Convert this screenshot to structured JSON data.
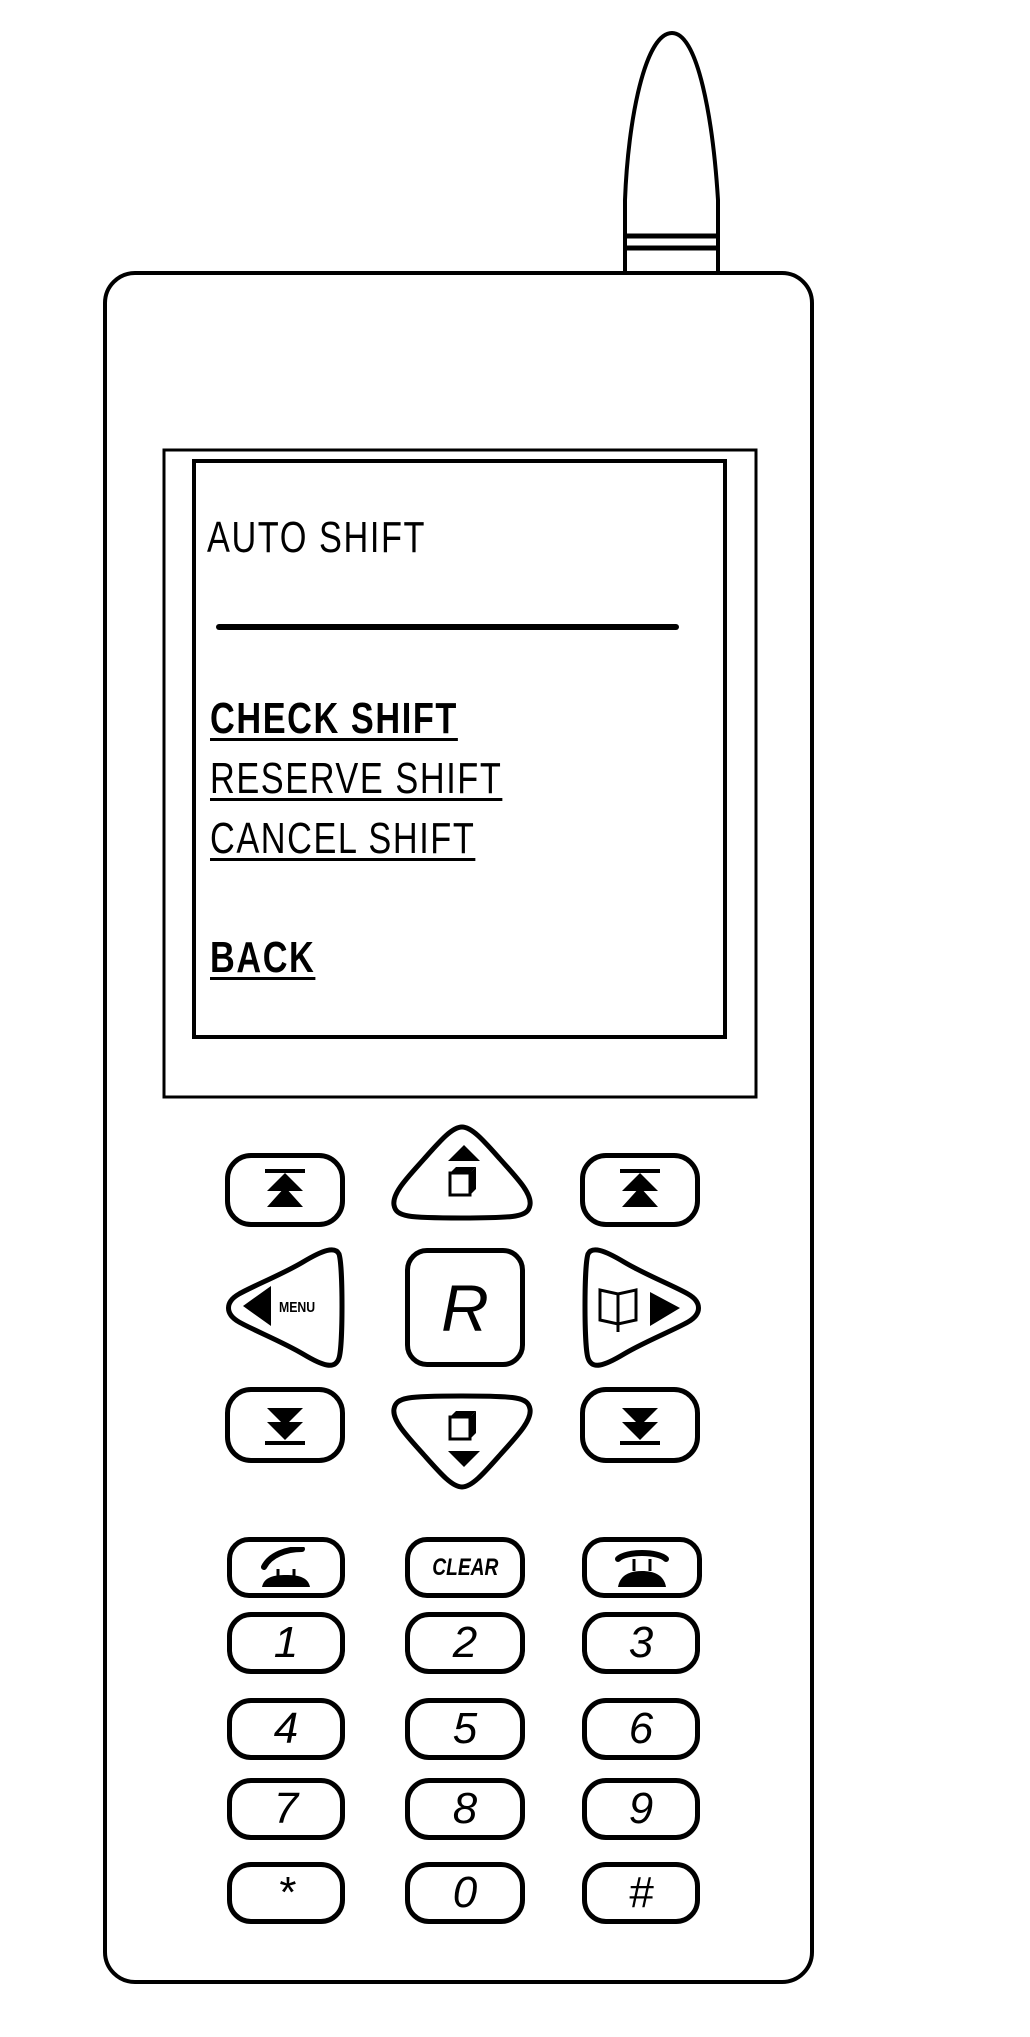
{
  "device": {
    "type": "mobile-phone-drawing",
    "screen": {
      "title": "AUTO SHIFT",
      "menu_items": [
        {
          "label": "CHECK SHIFT"
        },
        {
          "label": "RESERVE SHIFT"
        },
        {
          "label": "CANCEL SHIFT"
        }
      ],
      "back_label": "BACK"
    },
    "navigation_keys": {
      "scroll_top_left": {
        "icon": "double-up-arrow-bar-icon"
      },
      "page_up": {
        "icon": "page-up-icon"
      },
      "scroll_top_right": {
        "icon": "double-up-arrow-bar-icon"
      },
      "left_menu": {
        "icon": "left-triangle-icon",
        "label": "MENU"
      },
      "center": {
        "label": "R"
      },
      "right_book": {
        "icon": "book-icon"
      },
      "scroll_bottom_left": {
        "icon": "double-down-arrow-bar-icon"
      },
      "page_down": {
        "icon": "page-down-icon"
      },
      "scroll_bottom_right": {
        "icon": "double-down-arrow-bar-icon"
      }
    },
    "call_keys": {
      "send": {
        "icon": "phone-off-hook-icon"
      },
      "clear": {
        "label": "CLEAR"
      },
      "end": {
        "icon": "phone-on-hook-icon"
      }
    },
    "keypad": {
      "keys": [
        "1",
        "2",
        "3",
        "4",
        "5",
        "6",
        "7",
        "8",
        "9",
        "*",
        "0",
        "#"
      ]
    }
  }
}
